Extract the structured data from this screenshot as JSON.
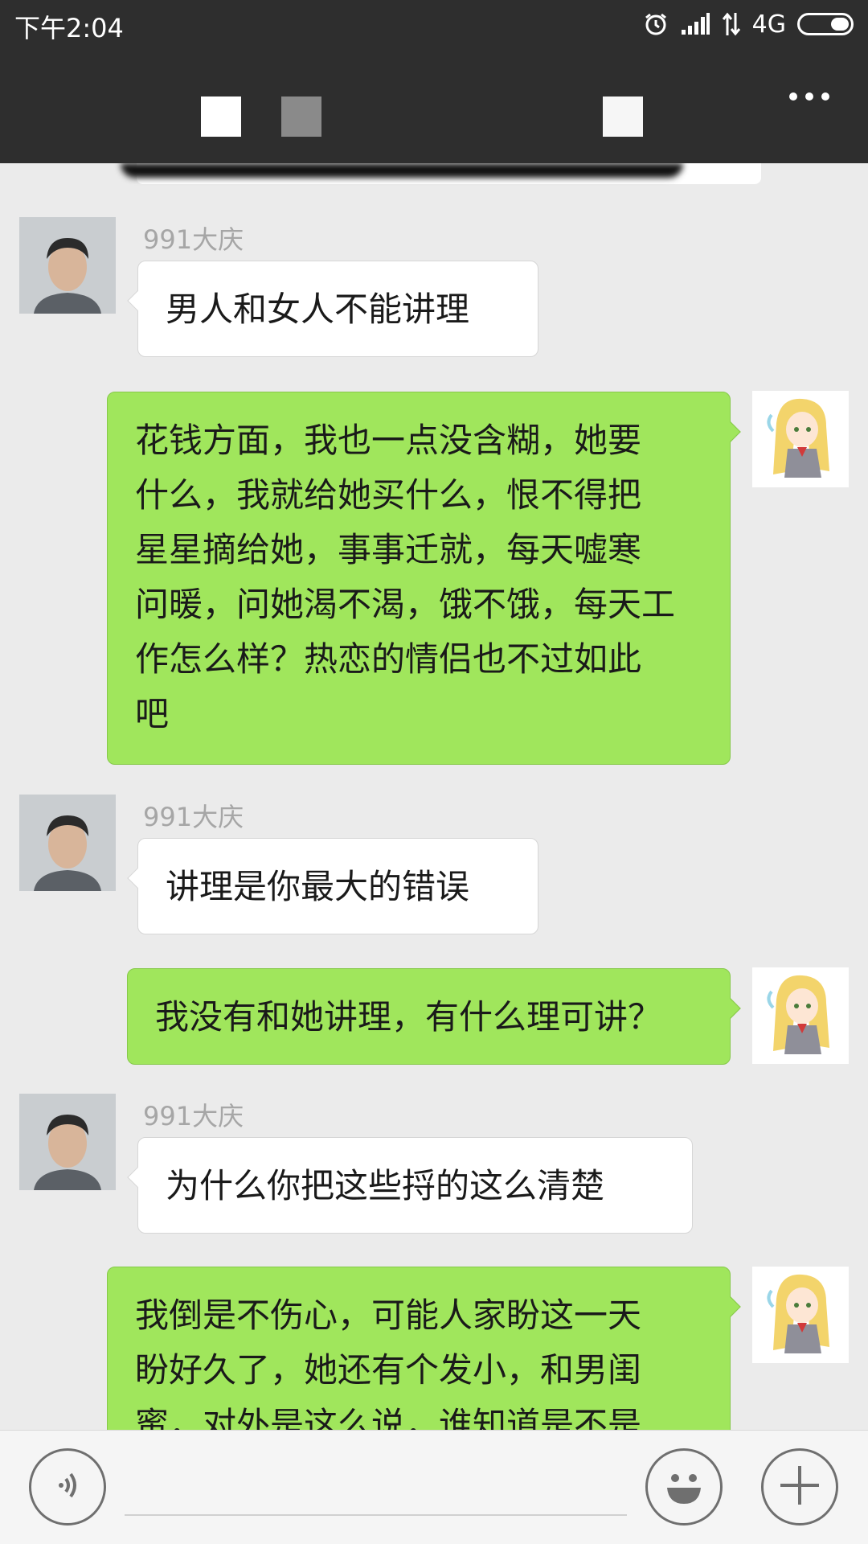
{
  "status_bar": {
    "time": "下午2:04",
    "network": "4G"
  },
  "conversation": {
    "messages": [
      {
        "side": "in",
        "sender": "991大庆",
        "text": "男人和女人不能讲理"
      },
      {
        "side": "out",
        "lines": [
          "花钱方面，我也一点没含糊，她要",
          "什么，我就给她买什么，恨不得把",
          "星星摘给她，事事迁就，每天嘘寒",
          "问暖，问她渴不渴，饿不饿，每天工",
          "作怎么样？热恋的情侣也不过如此",
          "吧"
        ]
      },
      {
        "side": "in",
        "sender": "991大庆",
        "text": "讲理是你最大的错误"
      },
      {
        "side": "out",
        "lines": [
          "我没有和她讲理，有什么理可讲？"
        ]
      },
      {
        "side": "in",
        "sender": "991大庆",
        "text": "为什么你把这些捋的这么清楚"
      },
      {
        "side": "out",
        "lines": [
          "我倒是不伤心，可能人家盼这一天",
          "盼好久了，她还有个发小，和男闺",
          "蜜，对外是这么说，谁知道是不是"
        ]
      }
    ]
  },
  "colors": {
    "bar": "#2e2e2e",
    "chat_bg": "#ebebeb",
    "bubble_out": "#a0e65c",
    "bubble_in": "#ffffff"
  },
  "icons": [
    "alarm-icon",
    "signal-icon",
    "data-arrows-icon",
    "battery-icon",
    "more-icon",
    "voice-icon",
    "emoji-icon",
    "plus-icon"
  ]
}
